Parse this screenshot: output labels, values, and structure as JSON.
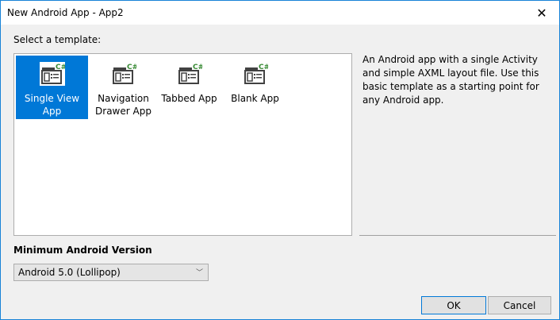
{
  "window": {
    "title": "New Android App - App2"
  },
  "templates_label": "Select a template:",
  "templates": [
    {
      "label": "Single View App",
      "selected": true
    },
    {
      "label": "Navigation Drawer App",
      "selected": false
    },
    {
      "label": "Tabbed App",
      "selected": false
    },
    {
      "label": "Blank App",
      "selected": false
    }
  ],
  "icon_badge": "C#",
  "description": "An Android app with a single Activity and simple AXML layout file. Use this basic template as a starting point for any Android app.",
  "min_version": {
    "label": "Minimum Android Version",
    "value": "Android 5.0 (Lollipop)"
  },
  "buttons": {
    "ok": "OK",
    "cancel": "Cancel"
  },
  "colors": {
    "accent": "#0078d7",
    "badge": "#388a34"
  }
}
